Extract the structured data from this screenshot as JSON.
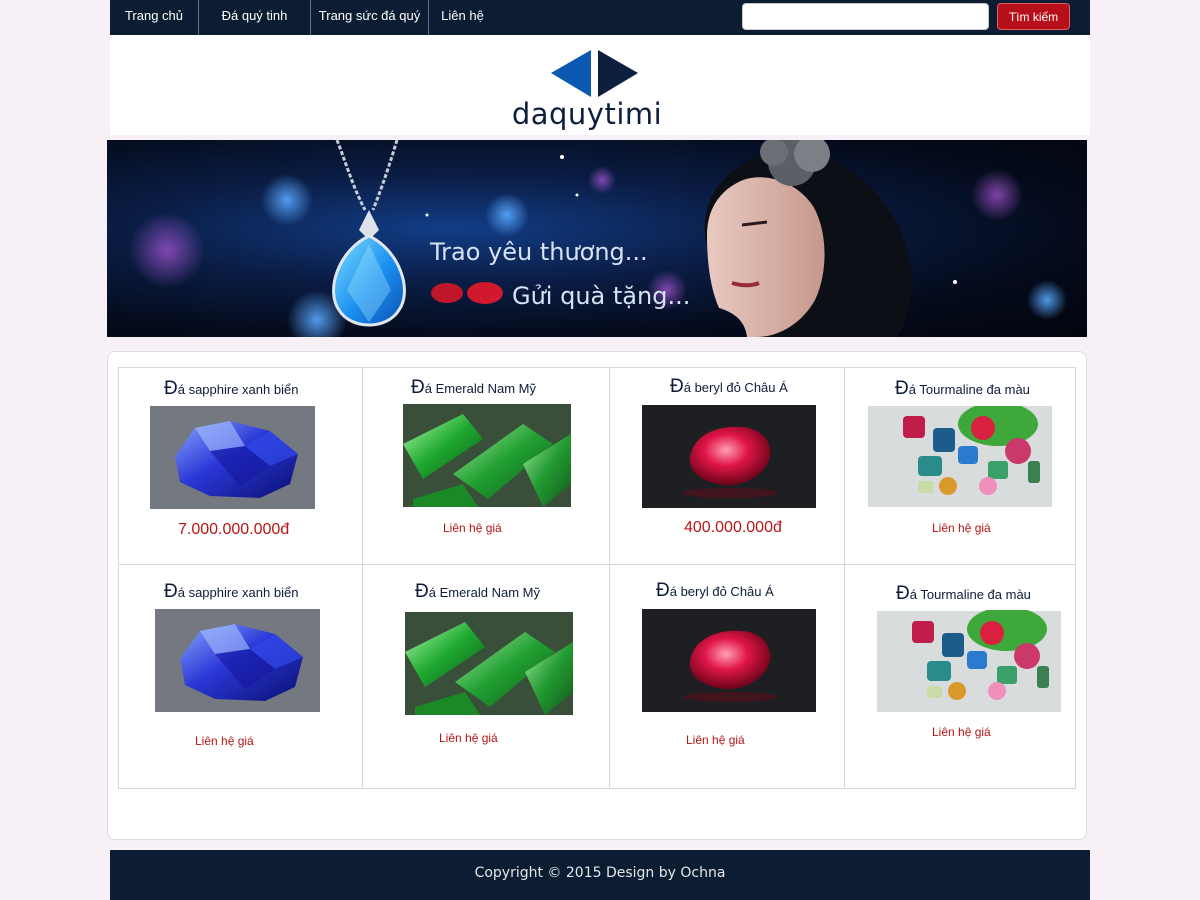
{
  "nav": {
    "items": [
      "Trang chủ",
      "Đá quý tinh",
      "Trang sức đá quý",
      "Liên hệ"
    ],
    "search_placeholder": "",
    "search_button": "Tìm kiếm"
  },
  "logo": {
    "text": "daquytimi",
    "colors": {
      "left": "#0a58b0",
      "right": "#0d1f3f"
    }
  },
  "banner": {
    "line1": "Trao yêu thương...",
    "line2": "Gửi quà tặng..."
  },
  "products": [
    {
      "title_initial": "Đ",
      "title_rest": "á sapphire xanh biển",
      "price": "7.000.000.000đ",
      "contact": "",
      "image": "blue-sapphire-icon"
    },
    {
      "title_initial": "Đ",
      "title_rest": "á Emerald Nam Mỹ",
      "price": "",
      "contact": "Liên hệ giá",
      "image": "green-emerald-icon"
    },
    {
      "title_initial": "Đ",
      "title_rest": "á beryl đỏ Châu Á",
      "price": "400.000.000đ",
      "contact": "",
      "image": "red-beryl-icon"
    },
    {
      "title_initial": "Đ",
      "title_rest": "á Tourmaline đa màu",
      "price": "",
      "contact": "Liên hệ giá",
      "image": "tourmaline-mix-icon"
    },
    {
      "title_initial": "Đ",
      "title_rest": "á sapphire xanh biển",
      "price": "",
      "contact": "Liên hệ giá",
      "image": "blue-sapphire-icon"
    },
    {
      "title_initial": "Đ",
      "title_rest": "á Emerald Nam Mỹ",
      "price": "",
      "contact": "Liên hệ giá",
      "image": "green-emerald-icon"
    },
    {
      "title_initial": "Đ",
      "title_rest": "á beryl đỏ Châu Á",
      "price": "",
      "contact": "Liên hệ giá",
      "image": "red-beryl-icon"
    },
    {
      "title_initial": "Đ",
      "title_rest": "á Tourmaline đa màu",
      "price": "",
      "contact": "Liên hệ giá",
      "image": "tourmaline-mix-icon"
    }
  ],
  "footer": {
    "text": "Copyright © 2015 Design by Ochna"
  },
  "colors": {
    "nav_bg": "#0b1c33",
    "accent_red": "#b8101a",
    "price_red": "#b81515"
  }
}
